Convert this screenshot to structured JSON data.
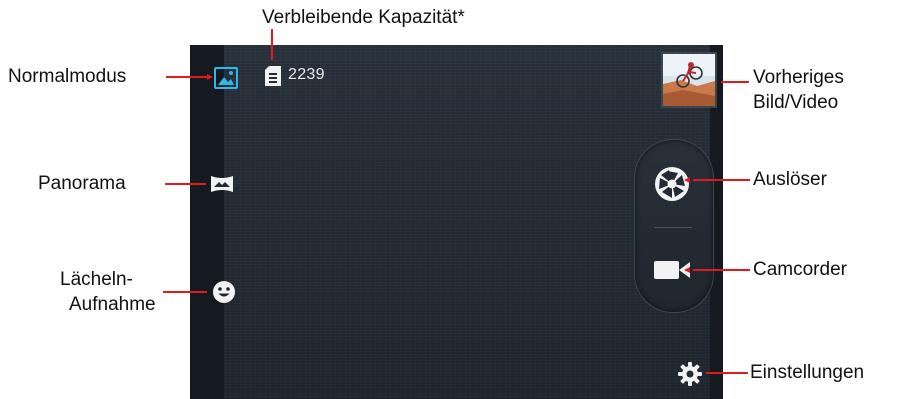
{
  "capacity": {
    "remaining_count": "2239"
  },
  "labels": {
    "capacity": "Verbleibende Kapazität*",
    "normal_mode": "Normalmodus",
    "panorama": "Panorama",
    "smile_line1": "Lächeln-",
    "smile_line2": "Aufnahme",
    "previous_line1": "Vorheriges",
    "previous_line2": "Bild/Video",
    "shutter": "Auslöser",
    "camcorder": "Camcorder",
    "settings": "Einstellungen"
  },
  "icons": {
    "normal_mode": "image-icon",
    "capacity": "sd-card-icon",
    "panorama": "panorama-icon",
    "smile": "smile-icon",
    "shutter": "shutter-aperture-icon",
    "camcorder": "video-camera-icon",
    "settings": "gear-icon"
  },
  "colors": {
    "callout_lines": "#e01b1b",
    "active_mode": "#33b5e5",
    "icon_white": "#f2f2f2"
  }
}
